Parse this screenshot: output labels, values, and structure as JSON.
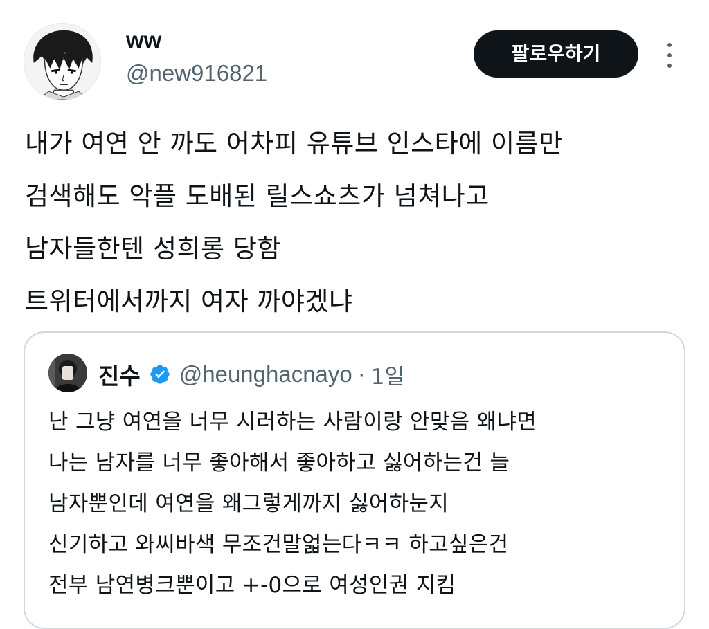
{
  "author": {
    "display_name": "ww",
    "handle": "@new916821",
    "avatar_icon": "manga-portrait-avatar"
  },
  "actions": {
    "follow_label": "팔로우하기",
    "more_icon": "more-vertical-icon"
  },
  "tweet": {
    "lines": [
      "내가 여연 안 까도 어차피 유튜브 인스타에 이름만",
      "검색해도 악플 도배된 릴스쇼츠가 넘쳐나고",
      "남자들한텐 성희롱 당함",
      "트위터에서까지 여자 까야겠냐"
    ]
  },
  "quoted": {
    "display_name": "진수",
    "verified_icon": "verified-badge-icon",
    "handle": "@heunghacnayo",
    "separator": "·",
    "time": "1일",
    "lines": [
      "난 그냥 여연을 너무 시러하는 사람이랑 안맞음 왜냐면",
      "나는 남자를 너무 좋아해서 좋아하고 싫어하는건 늘",
      "남자뿐인데 여연을 왜그렇게까지 싫어하눈지",
      "신기하고 와씨바색 무조건말얿는다ㅋㅋ 하고싶은건",
      "전부 남연병크뿐이고 +-0으로 여성인권 지킴"
    ]
  },
  "colors": {
    "text_primary": "#0f1419",
    "text_secondary": "#536471",
    "button_bg": "#0f1419",
    "button_text": "#ffffff",
    "border": "#cfd9de",
    "verified": "#1d9bf0"
  }
}
